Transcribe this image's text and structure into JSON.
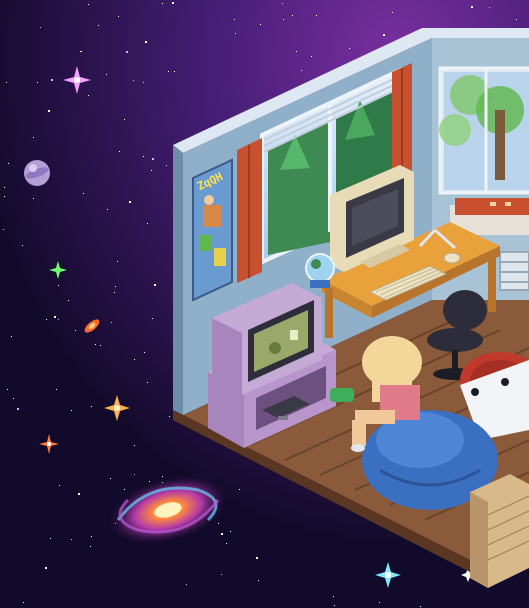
{
  "scene": {
    "type": "isometric-pixel-art",
    "palette": {
      "space_dark": "#120a2a",
      "space_purple": "#4a1f7a",
      "wall_blue": "#8fb0c8",
      "wall_shadow": "#6e8ea8",
      "floor_wood": "#8a5a3b",
      "floor_dark": "#5a3623",
      "desk_orange": "#e9a13b",
      "curtain_red": "#c8502e",
      "beanbag_blue": "#3b6fc0",
      "hair_blonde": "#f3d69a",
      "tv_screen_green": "#9aa86a",
      "monitor_screen": "#3a3a46"
    },
    "icons": [
      "star-sparkle-icon",
      "galaxy-icon",
      "planet-icon",
      "comet-icon"
    ],
    "poster": {
      "text": "ZqQH"
    }
  }
}
